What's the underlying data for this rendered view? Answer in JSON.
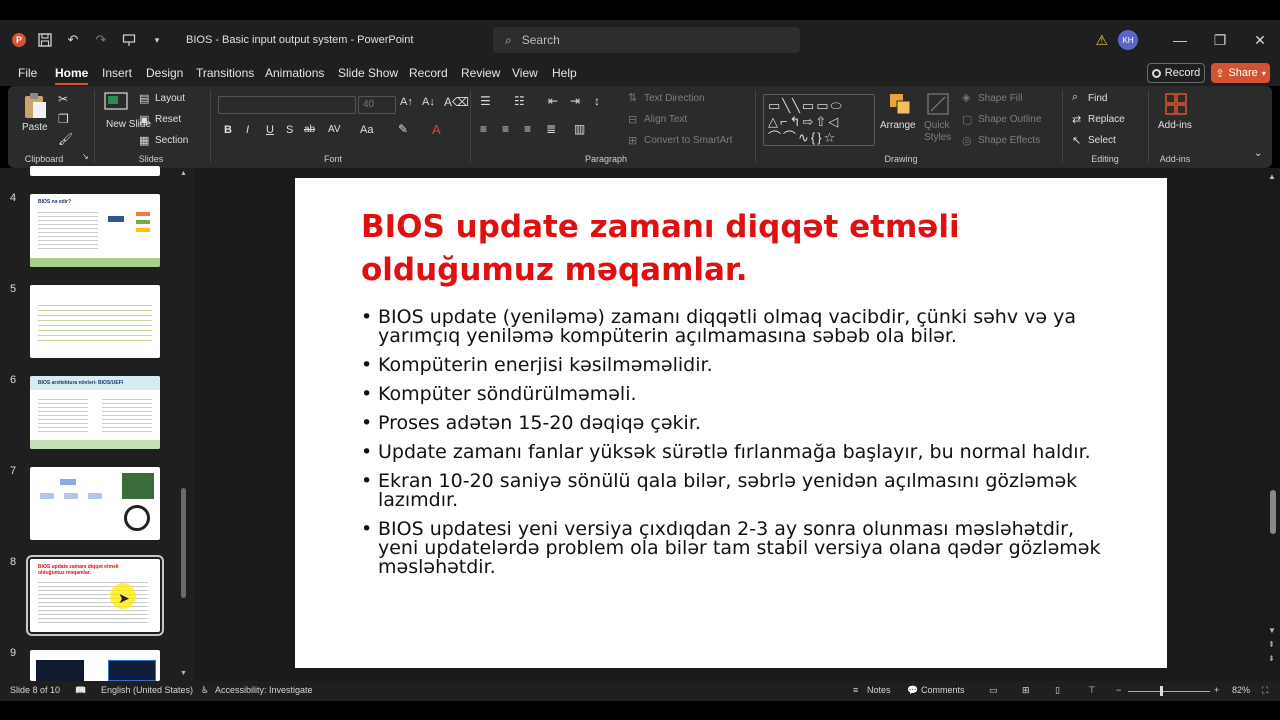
{
  "titlebar": {
    "app_logo": "P",
    "doc_title": "BIOS - Basic input output system  -  PowerPoint",
    "search_placeholder": "Search",
    "avatar_initials": "KH",
    "icons": [
      "powerpoint-logo-icon",
      "save-icon",
      "undo-icon",
      "redo-icon",
      "present-icon",
      "customize-icon",
      "search-icon",
      "warning-icon",
      "minimize-icon",
      "restore-icon",
      "close-icon"
    ]
  },
  "menu": {
    "tabs": [
      "File",
      "Home",
      "Insert",
      "Design",
      "Transitions",
      "Animations",
      "Slide Show",
      "Record",
      "Review",
      "View",
      "Help"
    ],
    "active_tab": "Home",
    "record_label": "Record",
    "share_label": "Share",
    "share_color": "#d35230"
  },
  "ribbon": {
    "clipboard": {
      "paste": "Paste",
      "label": "Clipboard"
    },
    "slides": {
      "new_slide": "New Slide",
      "layout": "Layout",
      "reset": "Reset",
      "section": "Section",
      "label": "Slides"
    },
    "font": {
      "size": "40",
      "label": "Font",
      "format_buttons": [
        "B",
        "I",
        "U",
        "S",
        "ab",
        "AV",
        "Aa"
      ]
    },
    "paragraph": {
      "text_direction": "Text Direction",
      "align_text": "Align Text",
      "convert_smartart": "Convert to SmartArt",
      "label": "Paragraph"
    },
    "drawing": {
      "arrange": "Arrange",
      "quick_styles": "Quick Styles",
      "shape_fill": "Shape Fill",
      "shape_outline": "Shape Outline",
      "shape_effects": "Shape Effects",
      "label": "Drawing"
    },
    "editing": {
      "find": "Find",
      "replace": "Replace",
      "select": "Select",
      "label": "Editing"
    },
    "addins": {
      "addins": "Add-ins",
      "label": "Add-ins"
    }
  },
  "thumbnails": [
    {
      "num": "4",
      "title": "BIOS nə edir?"
    },
    {
      "num": "5",
      "title": ""
    },
    {
      "num": "6",
      "title": "BIOS arxitektura növləri- BIOS/UEFI"
    },
    {
      "num": "7",
      "title": ""
    },
    {
      "num": "8",
      "title": "BIOS update zamanı diqqət etməli olduğumuz məqamlar.",
      "selected": true
    },
    {
      "num": "9",
      "title": ""
    }
  ],
  "slide": {
    "title": "BIOS update zamanı diqqət etməli olduğumuz məqamlar.",
    "title_color": "#e01010",
    "bullets": [
      "BIOS update (yeniləmə) zamanı diqqətli olmaq vacibdir, çünki səhv və ya yarımçıq yeniləmə kompüterin açılmamasına səbəb ola bilər.",
      "Kompüterin enerjisi kəsilməməlidir.",
      "Kompüter söndürülməməli.",
      "Proses adətən 15-20 dəqiqə çəkir.",
      "Update zamanı fanlar yüksək sürətlə fırlanmağa başlayır, bu normal haldır.",
      "Ekran 10-20 saniyə sönülü qala bilər, səbrlə yenidən açılmasını gözləmək lazımdır.",
      "BIOS updatesi yeni versiya çıxdıqdan 2-3  ay sonra olunması məsləhətdir, yeni updatelərdə problem ola bilər tam stabil versiya olana qədər gözləmək məsləhətdir."
    ]
  },
  "status": {
    "slide_count": "Slide 8 of 10",
    "language": "English (United States)",
    "accessibility": "Accessibility: Investigate",
    "notes": "Notes",
    "comments": "Comments",
    "zoom": "82%"
  }
}
